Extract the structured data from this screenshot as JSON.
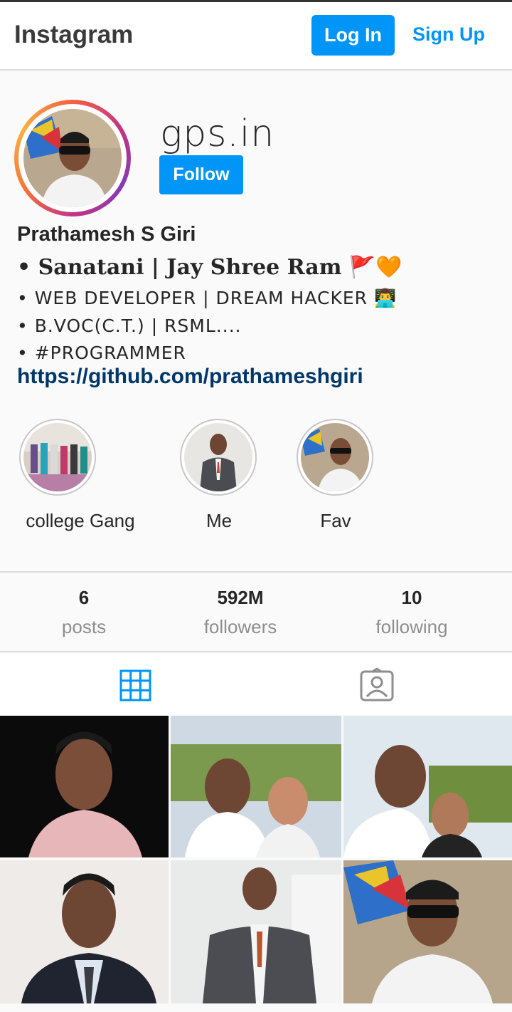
{
  "header": {
    "logo": "Instagram",
    "login_label": "Log In",
    "signup_label": "Sign Up"
  },
  "profile": {
    "username": "gps.in",
    "follow_label": "Follow",
    "full_name": "Prathamesh S Giri",
    "bio_line1": "• Sanatani | Jay Shree Ram 🚩🧡",
    "bio_line2": "• WEB DEVELOPER | DREAM HACKER 👨‍💻",
    "bio_line3": "• B.VOC(C.T.) | RSML....",
    "bio_line4": "• #PROGRAMMER",
    "link": "https://github.com/prathameshgiri"
  },
  "highlights": [
    {
      "label": "college Gang"
    },
    {
      "label": "Me"
    },
    {
      "label": "Fav"
    }
  ],
  "stats": {
    "posts": {
      "value": "6",
      "label": "posts"
    },
    "followers": {
      "value": "592M",
      "label": "followers"
    },
    "following": {
      "value": "10",
      "label": "following"
    }
  },
  "tabs": {
    "grid_icon": "grid-icon",
    "tagged_icon": "tagged-icon"
  },
  "colors": {
    "accent": "#0095f6",
    "link": "#00376b",
    "muted": "#8e8e8e"
  }
}
